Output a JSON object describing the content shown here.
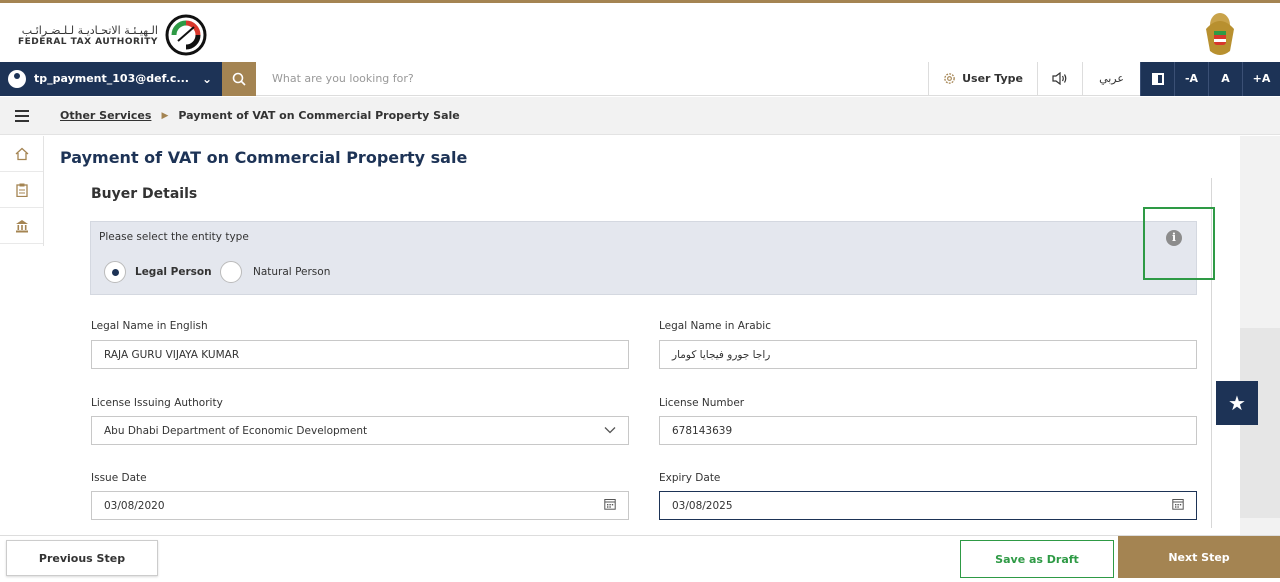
{
  "brand": {
    "name_ar": "الـهيـئـة الاتحـاديـة لـلـضـرائـب",
    "name_en": "FEDERAL TAX AUTHORITY"
  },
  "navbar": {
    "user": "tp_payment_103@def.c...",
    "search_placeholder": "What are you looking for?",
    "user_type": "User Type",
    "arabic": "عربي",
    "font_decrease": "-A",
    "font_normal": "A",
    "font_increase": "+A"
  },
  "breadcrumb": {
    "parent": "Other Services",
    "current": "Payment of VAT on Commercial Property Sale"
  },
  "page": {
    "title": "Payment of VAT on Commercial Property sale",
    "section_title": "Buyer Details",
    "entity_prompt": "Please select the entity type",
    "entity_options": [
      "Legal Person",
      "Natural Person"
    ],
    "entity_selected": "Legal Person"
  },
  "form": {
    "legal_name_en_label": "Legal Name in English",
    "legal_name_en_value": "RAJA GURU VIJAYA KUMAR",
    "legal_name_ar_label": "Legal Name in Arabic",
    "legal_name_ar_value": "راجا جورو فيجايا كومار",
    "license_authority_label": "License Issuing Authority",
    "license_authority_value": "Abu Dhabi Department of Economic Development",
    "license_number_label": "License Number",
    "license_number_value": "678143639",
    "issue_date_label": "Issue Date",
    "issue_date_value": "03/08/2020",
    "expiry_date_label": "Expiry Date",
    "expiry_date_value": "03/08/2025"
  },
  "footer": {
    "previous": "Previous Step",
    "draft": "Save as Draft",
    "next": "Next Step"
  },
  "colors": {
    "navy": "#1d3356",
    "gold": "#a48452",
    "green": "#2e9a45"
  }
}
